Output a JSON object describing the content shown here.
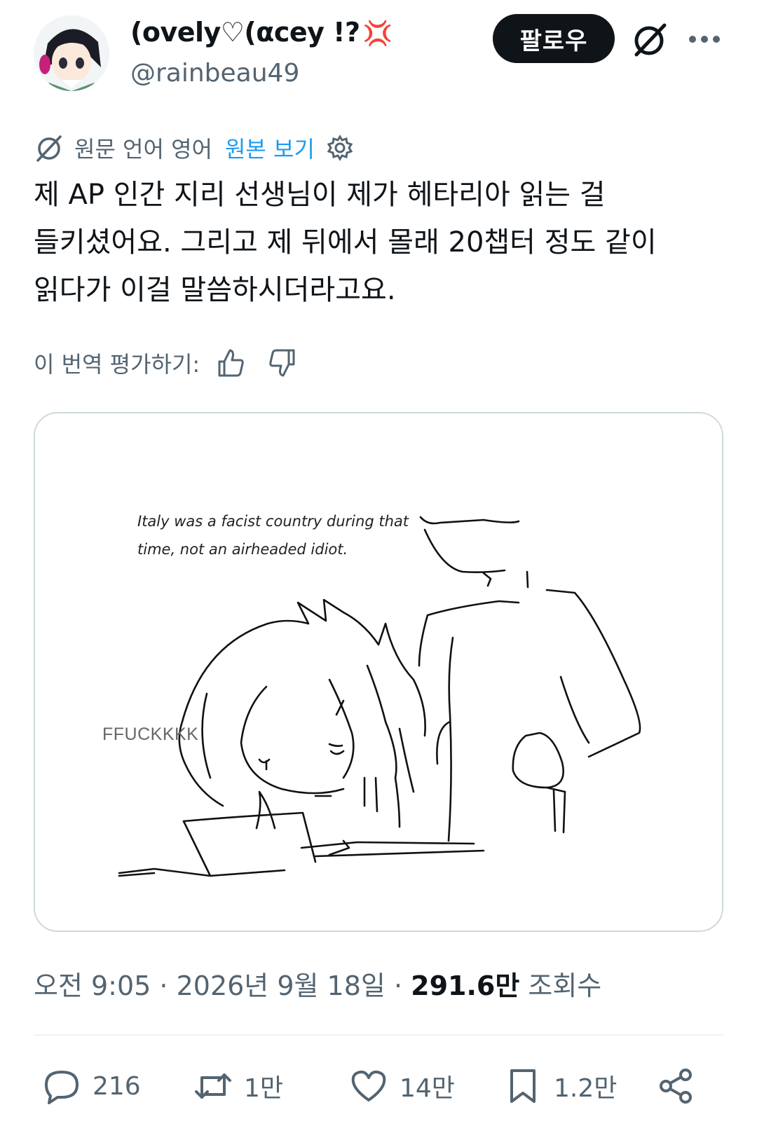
{
  "header": {
    "display_name": "(ovely♡(αcey !?",
    "display_name_emoji": "💢",
    "handle": "@rainbeau49",
    "follow_label": "팔로우"
  },
  "translation": {
    "source_language_label": "원문 언어 영어",
    "show_original_label": "원본 보기"
  },
  "tweet": {
    "text": "제 AP 인간 지리 선생님이 제가 헤타리아 읽는 걸 들키셨어요. 그리고 제 뒤에서 몰래 20챕터 정도 같이 읽다가 이걸 말씀하시더라고요."
  },
  "rating": {
    "label": "이 번역 평가하기:"
  },
  "media": {
    "caption_line1": "Italy was a facist country during that",
    "caption_line2": "time, not an airheaded idiot.",
    "sfx": "FFUCKKKK"
  },
  "meta": {
    "time": "오전 9:05",
    "date": "2026년 9월 18일",
    "views_count": "291.6만",
    "views_label": "조회수"
  },
  "actions": {
    "replies": "216",
    "reposts": "1만",
    "likes": "14만",
    "bookmarks": "1.2만"
  }
}
